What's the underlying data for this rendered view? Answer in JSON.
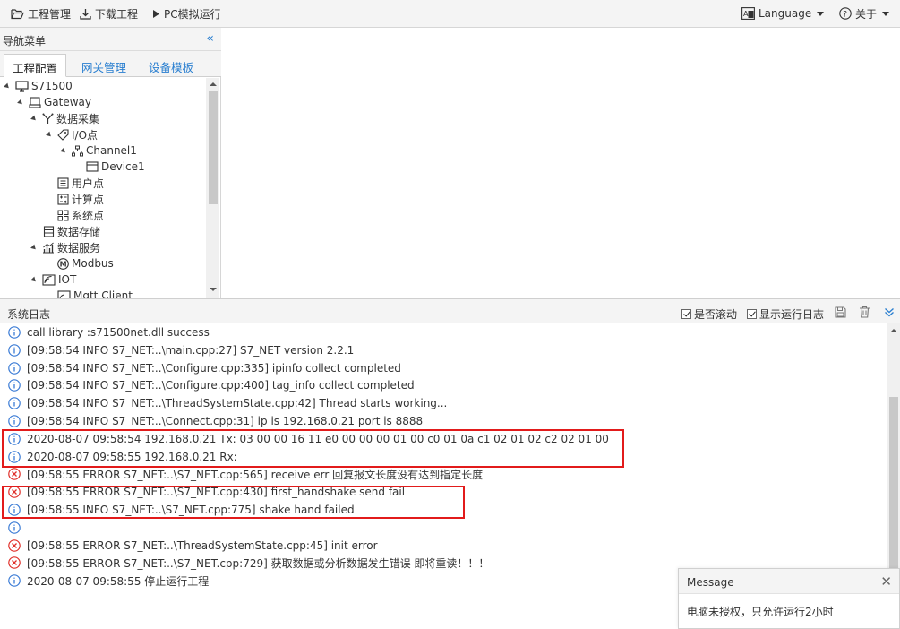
{
  "toolbar": {
    "project_mgmt": "工程管理",
    "download_project": "下载工程",
    "pc_simulate": "PC模拟运行",
    "language": "Language",
    "about": "关于"
  },
  "nav": {
    "title": "导航菜单",
    "tabs": [
      "工程配置",
      "网关管理",
      "设备模板"
    ],
    "tree": {
      "root": "S71500",
      "gateway": "Gateway",
      "data_collect": "数据采集",
      "io_points": "I/O点",
      "channel1": "Channel1",
      "device1": "Device1",
      "user_points": "用户点",
      "calc_points": "计算点",
      "system_points": "系统点",
      "data_storage": "数据存储",
      "data_service": "数据服务",
      "modbus": "Modbus",
      "iot": "IOT",
      "mqtt_client": "Mqtt Client"
    }
  },
  "log": {
    "title": "系统日志",
    "auto_scroll": "是否滚动",
    "show_runtime_log": "显示运行日志",
    "lines": [
      {
        "type": "info",
        "text": "call library :s71500net.dll success"
      },
      {
        "type": "info",
        "text": "[09:58:54 INFO S7_NET:..\\main.cpp:27] S7_NET version 2.2.1"
      },
      {
        "type": "info",
        "text": "[09:58:54 INFO S7_NET:..\\Configure.cpp:335] ipinfo collect completed"
      },
      {
        "type": "info",
        "text": "[09:58:54 INFO S7_NET:..\\Configure.cpp:400] tag_info collect completed"
      },
      {
        "type": "info",
        "text": "[09:58:54 INFO S7_NET:..\\ThreadSystemState.cpp:42] Thread starts working..."
      },
      {
        "type": "info",
        "text": "[09:58:54 INFO S7_NET:..\\Connect.cpp:31] ip is 192.168.0.21 port is 8888"
      },
      {
        "type": "info",
        "text": "2020-08-07 09:58:54 192.168.0.21 Tx: 03 00 00 16 11 e0 00 00 00 01 00 c0 01 0a c1 02 01 02 c2 02 01 00"
      },
      {
        "type": "info",
        "text": "2020-08-07 09:58:55 192.168.0.21 Rx:"
      },
      {
        "type": "error",
        "text": "[09:58:55 ERROR S7_NET:..\\S7_NET.cpp:565] receive err 回复报文长度没有达到指定长度"
      },
      {
        "type": "error",
        "text": "[09:58:55 ERROR S7_NET:..\\S7_NET.cpp:430] first_handshake send fail"
      },
      {
        "type": "info",
        "text": "[09:58:55 INFO S7_NET:..\\S7_NET.cpp:775] shake hand failed"
      },
      {
        "type": "info",
        "text": ""
      },
      {
        "type": "error",
        "text": "[09:58:55 ERROR S7_NET:..\\ThreadSystemState.cpp:45] init error"
      },
      {
        "type": "error",
        "text": "[09:58:55 ERROR S7_NET:..\\S7_NET.cpp:729] 获取数据或分析数据发生错误 即将重读！！！"
      },
      {
        "type": "info",
        "text": "2020-08-07 09:58:55 停止运行工程"
      }
    ]
  },
  "message": {
    "title": "Message",
    "text": "电脑未授权，只允许运行2小时"
  },
  "colors": {
    "info": "#3a7bd5",
    "error": "#e0302a",
    "highlight": "#e21b1b",
    "accent": "#2a7fd0"
  }
}
